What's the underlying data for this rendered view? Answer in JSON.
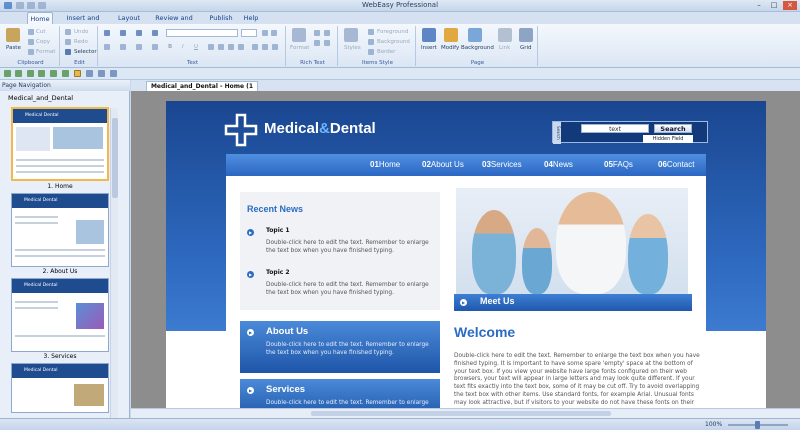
{
  "app": {
    "title": "WebEasy Professional"
  },
  "menu": {
    "tabs": [
      "Home",
      "Insert and Modify",
      "Layout",
      "Review and Tools",
      "Publish",
      "Help"
    ]
  },
  "ribbon": {
    "clipboard": {
      "label": "Clipboard",
      "paste": "Paste",
      "cut": "Cut",
      "copy": "Copy",
      "format": "Format"
    },
    "edit": {
      "label": "Edit",
      "undo": "Undo",
      "redo": "Redo",
      "selector": "Selector"
    },
    "text": {
      "label": "Text"
    },
    "richtext": {
      "label": "Rich Text",
      "format": "Format"
    },
    "itemsstyle": {
      "label": "Items Style",
      "styles": "Styles",
      "foreground": "Foreground",
      "background": "Background",
      "border": "Border"
    },
    "page": {
      "label": "Page",
      "insert": "Insert",
      "modify": "Modify",
      "background": "Background",
      "link": "Link",
      "grid": "Grid"
    }
  },
  "nav": {
    "header": "Page Navigation",
    "root": "Medical_and_Dental",
    "thumb_title": "Medical  Dental",
    "pages": [
      "1. Home",
      "2. About Us",
      "3. Services"
    ]
  },
  "doc": {
    "tab": "Medical_and_Dental - Home (1 of 6)"
  },
  "status": {
    "zoom": "100%"
  },
  "site": {
    "logo_a": "Medical",
    "logo_amp": "&",
    "logo_b": "Dental",
    "search_label": "Search",
    "search_value": "text",
    "search_button": "Search",
    "hidden_field": "Hidden Field",
    "nav": [
      {
        "num": "01",
        "label": "Home"
      },
      {
        "num": "02",
        "label": "About Us"
      },
      {
        "num": "03",
        "label": "Services"
      },
      {
        "num": "04",
        "label": "News"
      },
      {
        "num": "05",
        "label": "FAQs"
      },
      {
        "num": "06",
        "label": "Contact"
      }
    ],
    "news": {
      "title": "Recent News",
      "topics": [
        {
          "title": "Topic 1",
          "text": "Double-click here to edit the text. Remember to enlarge the text box when you have finished typing."
        },
        {
          "title": "Topic 2",
          "text": "Double-click here to edit the text. Remember to enlarge the text box when you have finished typing."
        }
      ]
    },
    "meet_us": "Meet Us",
    "about": {
      "title": "About Us",
      "text": "Double-click here to edit the text. Remember to enlarge the text box when you have finished typing."
    },
    "services": {
      "title": "Services",
      "text": "Double-click here to edit the text. Remember to enlarge"
    },
    "welcome": {
      "title": "Welcome",
      "text": "Double-click here to edit the text. Remember to enlarge the text box when you have finished typing. It is important to have some spare 'empty' space at the bottom of your text box. If you view your website have large fonts configured on their web browsers, your text will appear in large letters and may look quite different. If your text fits exactly into the text box, some of it may be cut off. Try to avoid overlapping the text box with other items. Use standard fonts, for example Arial. Unusual fonts may look attractive, but if visitors to your website do not have these fonts on their system, the results will"
    }
  },
  "colors": {
    "brand_dark": "#1a4690",
    "brand_light": "#4f8fe0",
    "accent": "#2b6cc4"
  }
}
